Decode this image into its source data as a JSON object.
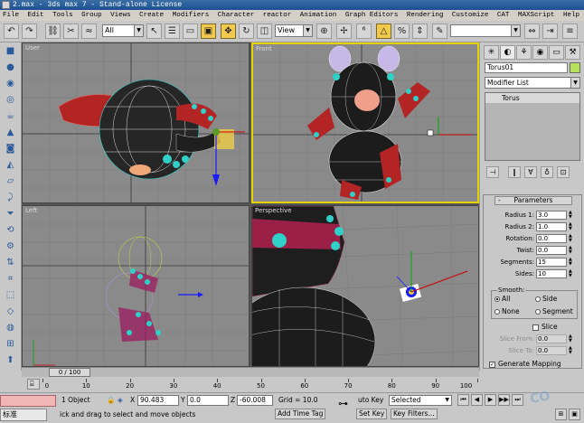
{
  "window": {
    "title": "2.max - 3ds max 7 - Stand-alone License"
  },
  "menu": [
    "File",
    "Edit",
    "Tools",
    "Group",
    "Views",
    "Create",
    "Modifiers",
    "Character",
    "reactor",
    "Animation",
    "Graph Editors",
    "Rendering",
    "Customize",
    "CAT",
    "MAXScript",
    "Help"
  ],
  "toolbar": {
    "selection_filter": "All",
    "reference_coord": "View"
  },
  "viewports": [
    {
      "label": "User"
    },
    {
      "label": "Front"
    },
    {
      "label": "Left"
    },
    {
      "label": "Perspective"
    }
  ],
  "command_panel": {
    "object_name": "Torus01",
    "object_color": "#b9e05a",
    "modifier_list": "Modifier List",
    "stack": [
      "Torus"
    ],
    "rollout_title": "Parameters",
    "params": [
      {
        "label": "Radius 1:",
        "value": "3.0"
      },
      {
        "label": "Radius 2:",
        "value": "1.0"
      },
      {
        "label": "Rotation:",
        "value": "0.0"
      },
      {
        "label": "Twist:",
        "value": "0.0"
      },
      {
        "label": "Segments:",
        "value": "15"
      },
      {
        "label": "Sides:",
        "value": "10"
      }
    ],
    "smooth": {
      "title": "Smooth:",
      "options": [
        "All",
        "Side",
        "None",
        "Segment"
      ],
      "selected": "All"
    },
    "slice": {
      "label": "Slice",
      "from_label": "Slice From:",
      "from_value": "0.0",
      "to_label": "Slice To:",
      "to_value": "0.0"
    },
    "generate_mapping": "Generate Mapping"
  },
  "timeline": {
    "slider": "0 / 100",
    "ticks": [
      "0",
      "10",
      "20",
      "30",
      "40",
      "50",
      "60",
      "70",
      "80",
      "90",
      "100"
    ]
  },
  "status": {
    "selection": "1 Object",
    "x_label": "X",
    "x": "90.483",
    "y_label": "Y",
    "y": "0.0",
    "z_label": "Z",
    "z": "-60.008",
    "grid": "Grid = 10.0",
    "auto_key": "uto Key",
    "key_mode": "Selected",
    "set_key": "Set Key",
    "key_filters": "Key Filters...",
    "prompt": "ick and drag to select and move objects",
    "add_time_tag": "Add Time Tag",
    "ime": "标准"
  }
}
